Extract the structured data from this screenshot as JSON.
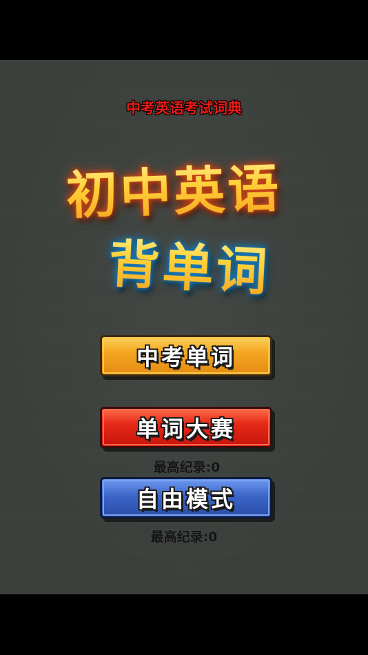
{
  "app": {
    "subtitle": "中考英语考试词典",
    "title_line1": "初中英语",
    "title_line2": "背单词"
  },
  "menu": {
    "buttons": [
      {
        "label": "中考单词",
        "color": "#f4a722"
      },
      {
        "label": "单词大赛",
        "color": "#e52a18"
      },
      {
        "label": "自由模式",
        "color": "#3b65c8"
      }
    ],
    "records": [
      {
        "label": "最高纪录:0"
      },
      {
        "label": "最高纪录:0"
      }
    ]
  },
  "colors": {
    "background": "#3b3f3b",
    "letterbox": "#000000",
    "subtitle": "#e81c16",
    "title_fill": "#ffd23a"
  }
}
